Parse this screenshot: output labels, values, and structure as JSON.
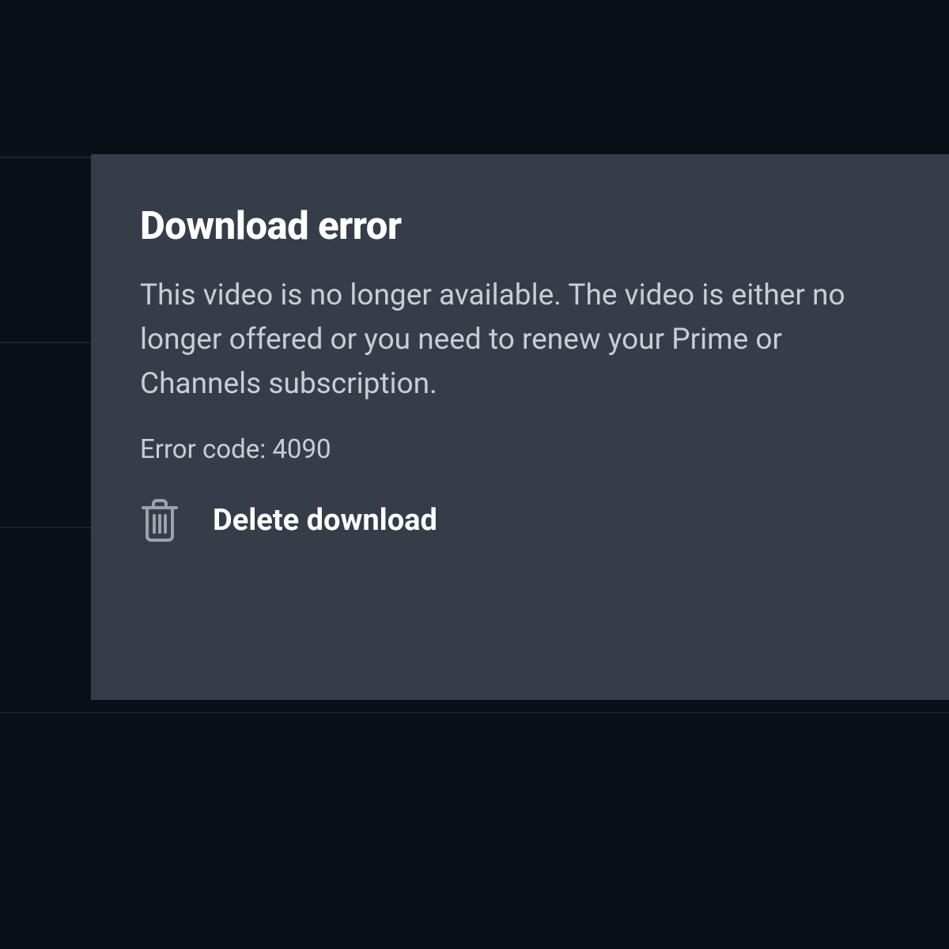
{
  "dialog": {
    "title": "Download error",
    "message": "This video is no longer available. The video is either no longer offered or you need to renew your Prime or Channels subscription.",
    "error_code_label": "Error code: 4090",
    "delete_label": "Delete download"
  }
}
